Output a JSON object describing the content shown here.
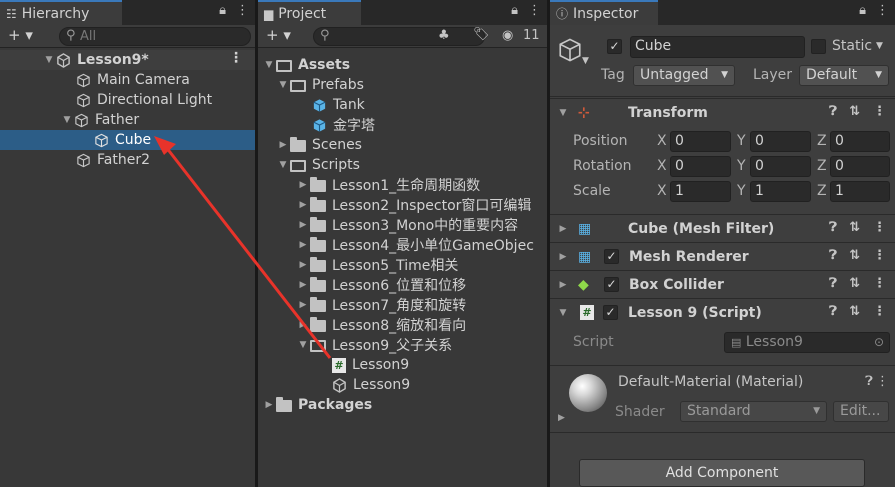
{
  "hierarchy": {
    "tab_label": "Hierarchy",
    "add_label": "+ ▾",
    "search_placeholder": "All",
    "scene": "Lesson9*",
    "items": [
      "Main Camera",
      "Directional Light",
      "Father",
      "Cube",
      "Father2"
    ]
  },
  "project": {
    "tab_label": "Project",
    "add_label": "+ ▾",
    "hidden_count": "11",
    "tree": {
      "assets": "Assets",
      "prefabs": "Prefabs",
      "tank": "Tank",
      "tower": "金字塔",
      "scenes": "Scenes",
      "scripts": "Scripts",
      "lessons": [
        "Lesson1_生命周期函数",
        "Lesson2_Inspector窗口可编辑",
        "Lesson3_Mono中的重要内容",
        "Lesson4_最小单位GameObjec",
        "Lesson5_Time相关",
        "Lesson6_位置和位移",
        "Lesson7_角度和旋转",
        "Lesson8_缩放和看向"
      ],
      "lesson9": "Lesson9_父子关系",
      "lesson9_script": "Lesson9",
      "lesson9_scene": "Lesson9",
      "packages": "Packages"
    }
  },
  "inspector": {
    "tab_label": "Inspector",
    "object_name": "Cube",
    "static_label": "Static",
    "tag_label": "Tag",
    "tag_value": "Untagged",
    "layer_label": "Layer",
    "layer_value": "Default",
    "transform": {
      "title": "Transform",
      "position_label": "Position",
      "rotation_label": "Rotation",
      "scale_label": "Scale",
      "axis_x": "X",
      "axis_y": "Y",
      "axis_z": "Z",
      "position": [
        "0",
        "0",
        "0"
      ],
      "rotation": [
        "0",
        "0",
        "0"
      ],
      "scale": [
        "1",
        "1",
        "1"
      ]
    },
    "components": [
      "Cube (Mesh Filter)",
      "Mesh Renderer",
      "Box Collider",
      "Lesson 9 (Script)"
    ],
    "script_label": "Script",
    "script_value": "Lesson9",
    "material": {
      "name": "Default-Material (Material)",
      "shader_label": "Shader",
      "shader_value": "Standard",
      "edit_label": "Edit..."
    },
    "add_component": "Add Component"
  },
  "colors": {
    "selection": "#2c5d87",
    "arrow": "#e8332a",
    "tab_accent": "#3a79bb"
  }
}
